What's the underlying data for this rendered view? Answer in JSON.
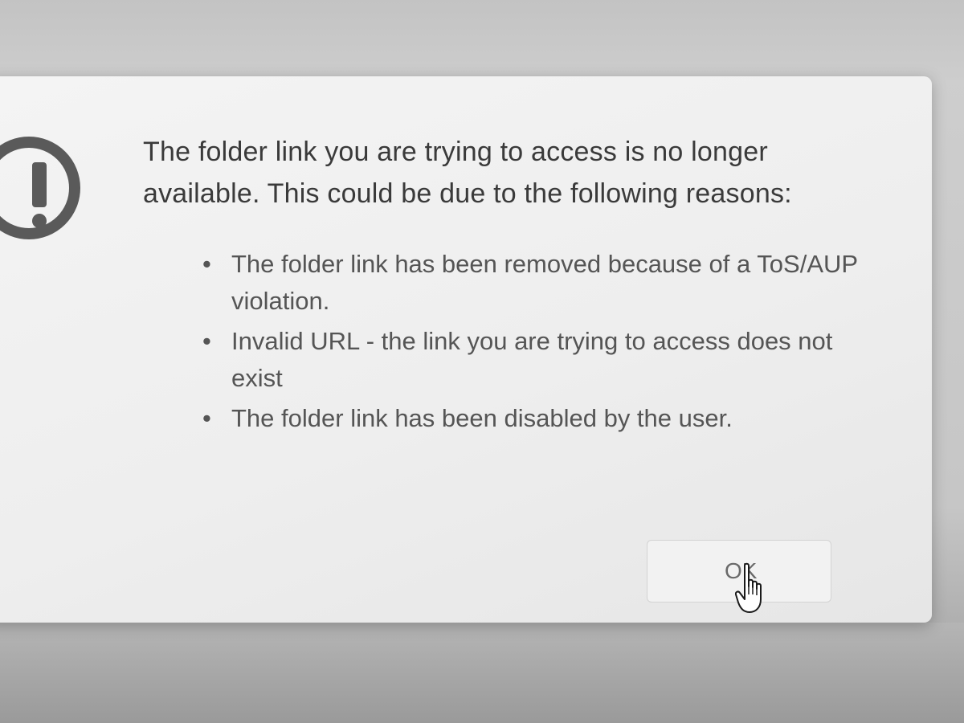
{
  "dialog": {
    "message": "The folder link you are trying to access is no longer available. This could be due to the following reasons:",
    "reasons": [
      "The folder link has been removed because of a ToS/AUP violation.",
      "Invalid URL - the link you are trying to access does not exist",
      "The folder link has been disabled by the user."
    ],
    "ok_label": "OK",
    "icon": "warning-exclamation-icon",
    "bullet": "•"
  },
  "cursor": {
    "icon": "hand-pointer-icon"
  },
  "colors": {
    "text": "#3a3a3a",
    "icon": "#5a5a5a",
    "dialog_background": "#f0f0f0"
  }
}
